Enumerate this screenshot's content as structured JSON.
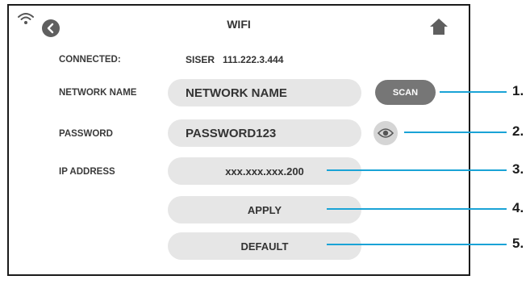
{
  "header": {
    "title": "WIFI"
  },
  "connected": {
    "label": "CONNECTED:",
    "value": "SISER   111.222.3.444"
  },
  "network": {
    "label": "NETWORK NAME",
    "value": "NETWORK NAME",
    "scan_label": "SCAN"
  },
  "password": {
    "label": "PASSWORD",
    "value": "PASSWORD123"
  },
  "ip": {
    "label": "IP ADDRESS",
    "value": "xxx.xxx.xxx.200"
  },
  "buttons": {
    "apply": "APPLY",
    "default": "DEFAULT"
  },
  "callouts": [
    "1.",
    "2.",
    "3.",
    "4.",
    "5."
  ],
  "colors": {
    "accent_line": "#1aa3d6",
    "field_bg": "#e6e6e6",
    "scan_bg": "#767676",
    "icon_dark": "#555555"
  },
  "icons": {
    "wifi": "wifi-icon",
    "back": "back-arrow-icon",
    "home": "home-icon",
    "eye": "eye-icon"
  }
}
